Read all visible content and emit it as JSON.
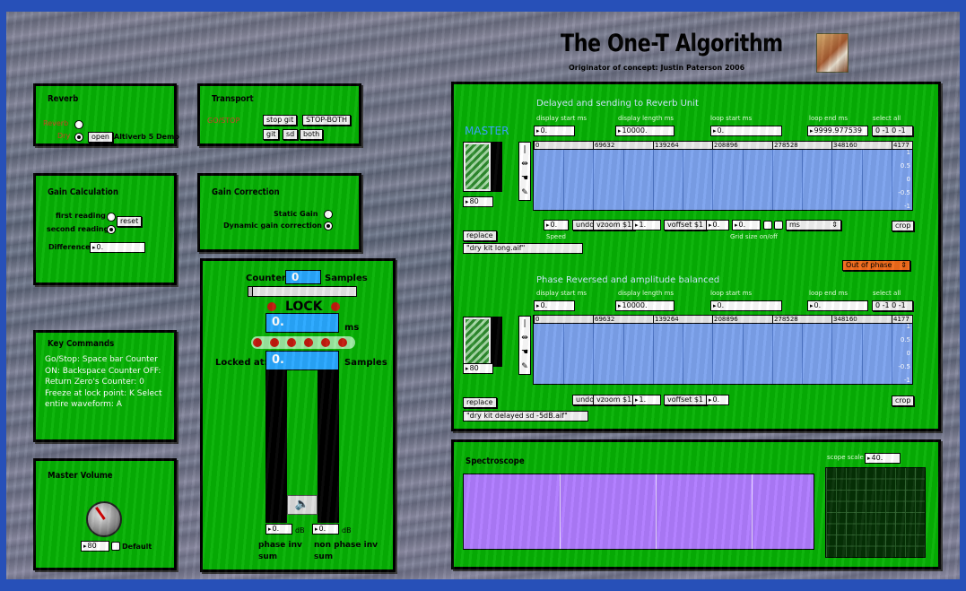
{
  "header": {
    "title": "The One-T Algorithm",
    "subtitle": "Originator of concept: Justin Paterson 2006"
  },
  "reverb": {
    "title": "Reverb",
    "opt1": "Reverb",
    "opt2": "Dry",
    "open": "open",
    "plugin": "Altiverb 5 Demo"
  },
  "transport": {
    "title": "Transport",
    "gostop": "GO/STOP",
    "stop_git": "stop git",
    "stop_both": "STOP-BOTH",
    "git": "git",
    "sd": "sd",
    "both": "both"
  },
  "gaincalc": {
    "title": "Gain Calculation",
    "first": "first reading",
    "second": "second reading",
    "reset": "reset",
    "difference": "Difference",
    "diff_value": "0."
  },
  "gaincorr": {
    "title": "Gain Correction",
    "static": "Static Gain",
    "dynamic": "Dynamic gain correction"
  },
  "counter": {
    "label": "Counter:",
    "value": "0",
    "samples": "Samples",
    "lock": "LOCK",
    "ms_value": "0.",
    "ms": "ms",
    "locked_at": "Locked at:",
    "locked_value": "0.",
    "samples2": "Samples",
    "db1": "0.",
    "db2": "0.",
    "db_unit": "dB",
    "phase_inv": "phase inv",
    "non_phase_inv": "non phase inv",
    "sum": "sum"
  },
  "keys": {
    "title": "Key Commands",
    "text": "Go/Stop: Space bar Counter ON: Backspace Counter OFF: Return Zero's Counter: 0 Freeze at lock point: K Select entire waveform: A"
  },
  "master_vol": {
    "title": "Master Volume",
    "value": "80",
    "default": "Default"
  },
  "main": {
    "section1": "Delayed and sending to Reverb Unit",
    "master": "MASTER",
    "l_disp_start": "display start ms",
    "l_disp_len": "display length ms",
    "l_loop_start": "loop start ms",
    "l_loop_end": "loop end ms",
    "l_select_all": "select all",
    "disp_start": "0.",
    "disp_len": "10000.",
    "loop_start": "0.",
    "loop_end": "9999.977539",
    "select1": "0 -1 0 -1",
    "ticks": [
      "0",
      "69632",
      "139264",
      "208896",
      "278528",
      "348160",
      "4177"
    ],
    "amp": [
      "1",
      "0.5",
      "0",
      "-0.5",
      "-1"
    ],
    "level": "80",
    "replace": "replace",
    "file1": "\"dry kit long.aif\"",
    "speed_val": "0.",
    "undo": "undo",
    "vzoom": "vzoom $1",
    "vzoom_val": "1.",
    "voffset": "voffset $1",
    "voff_val": "0.",
    "grid_val": "0.",
    "unit": "ms",
    "speed": "Speed",
    "grid": "Grid size on/off",
    "crop": "crop",
    "phase_menu": "Out of phase",
    "section2": "Phase Reversed and amplitude balanced",
    "disp_start2": "0.",
    "disp_len2": "10000.",
    "loop_start2": "0.",
    "loop_end2": "0.",
    "select2": "0 -1 0 -1",
    "level2": "80",
    "file2": "\"dry kit delayed sd -5dB.aif\""
  },
  "spectro": {
    "title": "Spectroscope",
    "scope_label": "scope scale",
    "scope_val": "40."
  },
  "colors": {
    "panel": "#06b204",
    "wave": "#7da3ee",
    "spectrum": "#b07cff",
    "title_blue": "#29a8ff"
  }
}
